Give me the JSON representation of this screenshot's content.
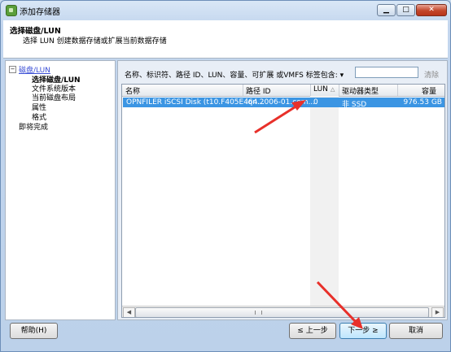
{
  "window": {
    "title": "添加存储器"
  },
  "header": {
    "title": "选择磁盘/LUN",
    "subtitle": "选择 LUN 创建数据存储或扩展当前数据存储"
  },
  "nav": {
    "group_label": "磁盘/LUN",
    "items": [
      "选择磁盘/LUN",
      "文件系统版本",
      "当前磁盘布局",
      "属性",
      "格式"
    ],
    "finish": "即将完成"
  },
  "filter": {
    "label": "名称、标识符、路径 ID、LUN、容量、可扩展 或VMFS 标签包含: ▾",
    "value": "",
    "clear_label": "清除"
  },
  "table": {
    "columns": [
      "名称",
      "路径 ID",
      "LUN",
      "驱动器类型",
      "容量"
    ],
    "rows": [
      {
        "name": "OPNFILER iSCSI Disk (t10.F405E464...",
        "path_id": "iqn.2006-01.com....",
        "lun": "0",
        "drive_type": "非 SSD",
        "capacity": "976.53 GB"
      }
    ]
  },
  "buttons": {
    "help": "帮助(H)",
    "back": "≤ 上一步",
    "next": "下一步 ≥",
    "cancel": "取消"
  },
  "colors": {
    "selection": "#3b95e3",
    "annotation_arrow": "#e8302a"
  }
}
